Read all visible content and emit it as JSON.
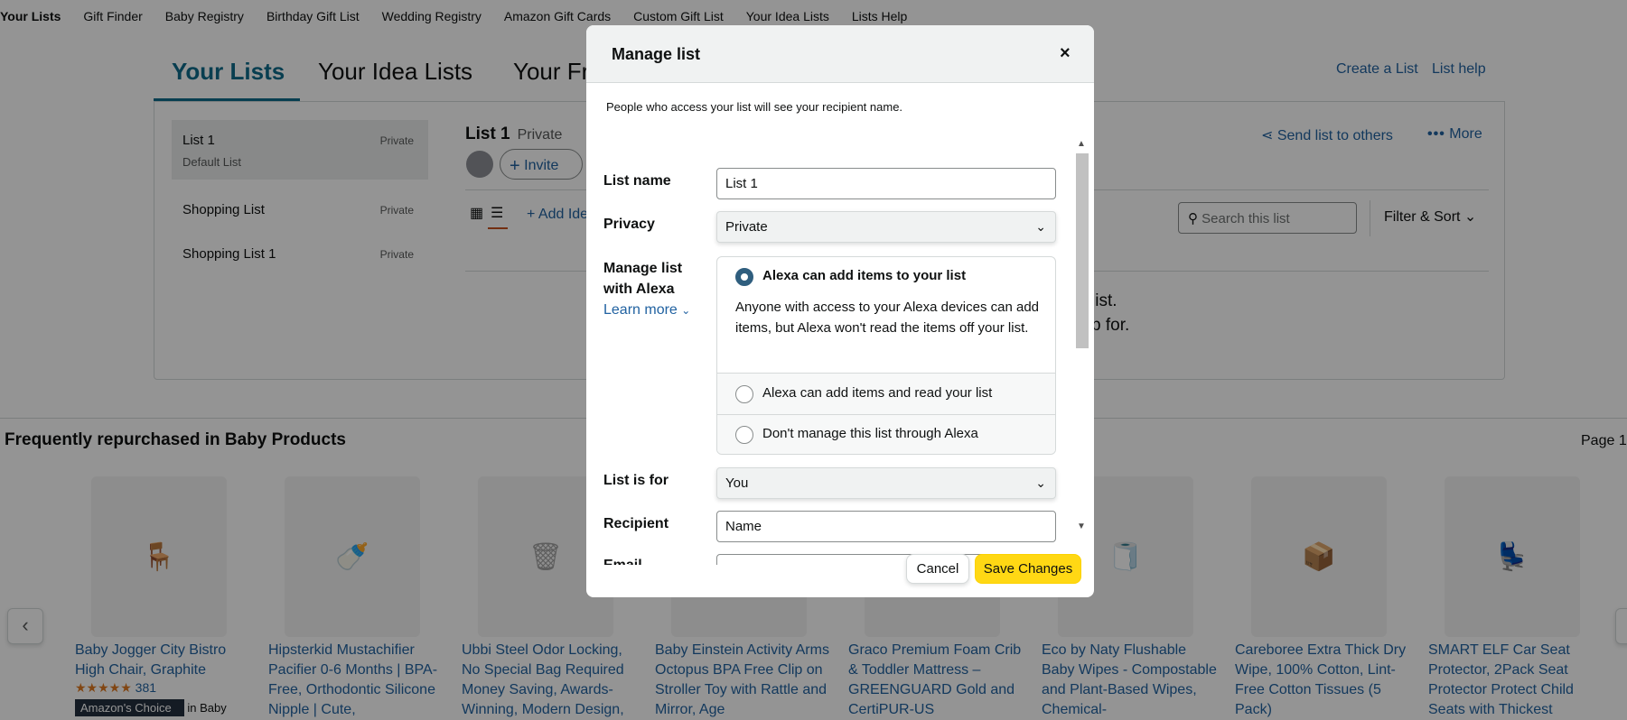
{
  "top_nav": [
    "Your Lists",
    "Gift Finder",
    "Baby Registry",
    "Birthday Gift List",
    "Wedding Registry",
    "Amazon Gift Cards",
    "Custom Gift List",
    "Your Idea Lists",
    "Lists Help"
  ],
  "tabs": [
    "Your Lists",
    "Your Idea Lists",
    "Your Fr"
  ],
  "header_links": {
    "create": "Create a List",
    "help": "List help"
  },
  "sidebar": [
    {
      "name": "List 1",
      "privacy": "Private",
      "sub": "Default List"
    },
    {
      "name": "Shopping List",
      "privacy": "Private",
      "sub": ""
    },
    {
      "name": "Shopping List 1",
      "privacy": "Private",
      "sub": ""
    }
  ],
  "list_view": {
    "title": "List 1",
    "privacy": "Private",
    "invite": "Invite",
    "send": "Send list to others",
    "more": "More",
    "add_idea": "+ Add Ide",
    "search_placeholder": "Search this list",
    "filter": "Filter & Sort",
    "empty_line1": "list.",
    "empty_line2": "p for."
  },
  "section": {
    "title": "Frequently repurchased in Baby Products",
    "page": "Page 1"
  },
  "products": [
    {
      "title": "Baby Jogger City Bistro High Chair, Graphite",
      "rating_count": "381",
      "badge": "Amazon's Choice",
      "badge_suffix": "in Baby"
    },
    {
      "title": "Hipsterkid Mustachifier Pacifier 0-6 Months | BPA-Free, Orthodontic Silicone Nipple | Cute,"
    },
    {
      "title": "Ubbi Steel Odor Locking, No Special Bag Required Money Saving, Awards-Winning, Modern Design,"
    },
    {
      "title": "Baby Einstein Activity Arms Octopus BPA Free Clip on Stroller Toy with Rattle and Mirror, Age"
    },
    {
      "title": "Graco Premium Foam Crib & Toddler Mattress – GREENGUARD Gold and CertiPUR-US"
    },
    {
      "title": "Eco by Naty Flushable Baby Wipes - Compostable and Plant-Based Wipes, Chemical-"
    },
    {
      "title": "Careboree Extra Thick Dry Wipe, 100% Cotton, Lint-Free Cotton Tissues (5 Pack)"
    },
    {
      "title": "SMART ELF Car Seat Protector, 2Pack Seat Protector Protect Child Seats with Thickest"
    }
  ],
  "modal": {
    "title": "Manage list",
    "close": "×",
    "note": "People who access your list will see your recipient name.",
    "labels": {
      "list_name": "List name",
      "privacy": "Privacy",
      "alexa_1": "Manage list",
      "alexa_2": "with Alexa",
      "learn_more": "Learn more",
      "list_for": "List is for",
      "recipient": "Recipient",
      "email": "Email"
    },
    "values": {
      "list_name": "List 1",
      "privacy": "Private",
      "list_for": "You",
      "recipient": "Name"
    },
    "alexa_options": [
      {
        "label": "Alexa can add items to your list",
        "desc": "Anyone with access to your Alexa devices can add items, but Alexa won't read the items off your list.",
        "checked": true
      },
      {
        "label": "Alexa can add items and read your list",
        "checked": false
      },
      {
        "label": "Don't manage this list through Alexa",
        "checked": false
      }
    ],
    "cancel": "Cancel",
    "save": "Save Changes"
  },
  "colors": {
    "accent": "#0f6b8a",
    "link": "#2162a1",
    "save_button": "#ffd814",
    "radio_checked": "#2f5e7e"
  }
}
